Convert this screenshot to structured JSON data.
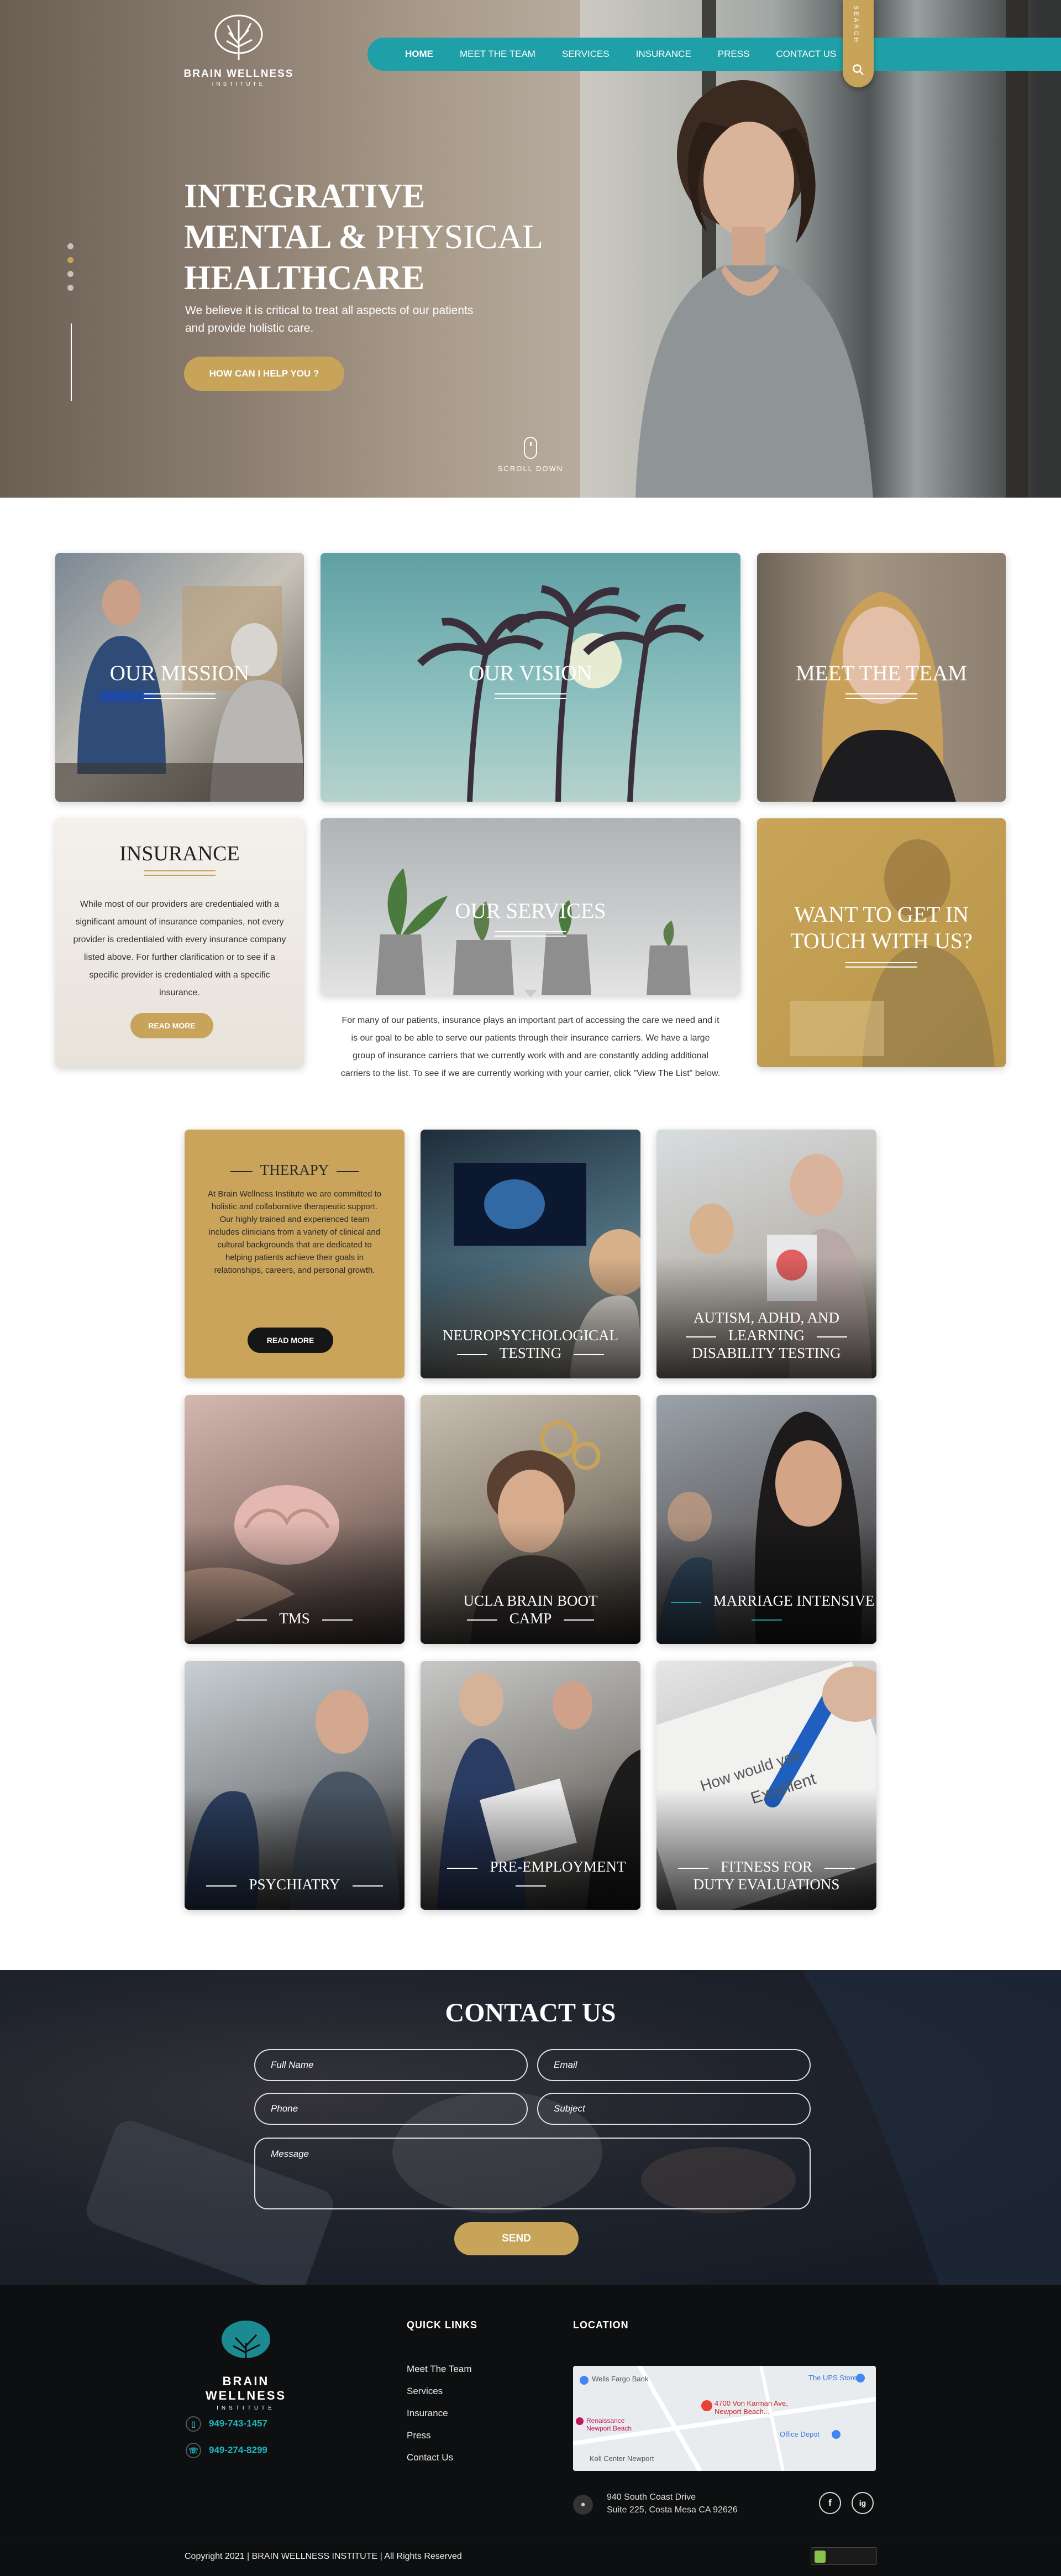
{
  "brand": {
    "name": "BRAIN WELLNESS",
    "sub": "INSTITUTE"
  },
  "nav": {
    "items": [
      "HOME",
      "MEET THE TEAM",
      "SERVICES",
      "INSURANCE",
      "PRESS",
      "CONTACT US"
    ],
    "search_label": "SEARCH"
  },
  "hero": {
    "title_line1": "INTEGRATIVE",
    "title_line2_bold": "MENTAL &",
    "title_line2_thin": "PHYSICAL",
    "title_line3": "HEALTHCARE",
    "description": "We believe it is critical to treat all aspects of our patients and provide holistic care.",
    "cta": "HOW CAN I HELP YOU ?",
    "scroll_label": "SCROLL DOWN",
    "active_slide": 1
  },
  "tiles": {
    "mission": "OUR MISSION",
    "vision": "OUR VISION",
    "team": "MEET THE TEAM",
    "insurance": {
      "title": "INSURANCE",
      "body": "While most of our providers are credentialed with a significant amount of insurance companies, not every provider is credentialed with every insurance company listed above. For further clarification or to see if a specific provider is credentialed with a specific insurance.",
      "button": "READ MORE"
    },
    "services": {
      "title": "OUR SERVICES",
      "body": "For many of our patients, insurance plays an important part of accessing the care we need and it is our goal to be able to serve our patients through their insurance carriers. We have a large group of insurance carriers that we currently work with and are constantly adding additional carriers to the list. To see if we are currently working with your carrier, click \"View The List\" below."
    },
    "contact": "WANT TO GET IN TOUCH WITH US?"
  },
  "services": {
    "therapy": {
      "title": "THERAPY",
      "body": "At Brain Wellness Institute we are committed to holistic and collaborative therapeutic support. Our highly trained and experienced team includes clinicians from a variety of clinical and cultural backgrounds that are dedicated to helping patients achieve their goals in relationships, careers, and personal growth.",
      "button": "READ MORE"
    },
    "items": [
      {
        "line1": "NEUROPSYCHOLOGICAL",
        "line2": "TESTING"
      },
      {
        "line1": "AUTISM, ADHD, AND",
        "line2": "LEARNING",
        "line3": "DISABILITY TESTING"
      },
      {
        "line1": "TMS"
      },
      {
        "line1": "UCLA BRAIN BOOT",
        "line2": "CAMP"
      },
      {
        "line1": "MARRIAGE INTENSIVE"
      },
      {
        "line1": "PSYCHIATRY"
      },
      {
        "line1": "PRE-EMPLOYMENT"
      },
      {
        "line1": "FITNESS FOR",
        "line2": "DUTY EVALUATIONS"
      }
    ]
  },
  "contact": {
    "title": "CONTACT US",
    "full_name": "Full Name",
    "email": "Email",
    "phone": "Phone",
    "subject": "Subject",
    "message": "Message",
    "send": "SEND"
  },
  "footer": {
    "phone1": "949-743-1457",
    "phone2": "949-274-8299",
    "quick_links_title": "QUICK LINKS",
    "quick_links": [
      "Meet The Team",
      "Services",
      "Insurance",
      "Press",
      "Contact Us"
    ],
    "location_title": "LOCATION",
    "map_labels": {
      "bank": "Wells Fargo Bank",
      "ups": "The UPS Store",
      "pin": "4700 Von Karman Ave, Newport Beach...",
      "office": "Office Depot",
      "renaissance": "Renaissance Newport Beach",
      "koll": "Koll Center Newport"
    },
    "address_line1": "940 South Coast Drive",
    "address_line2": "Suite 225, Costa Mesa CA 92626",
    "social": [
      "f",
      "ig"
    ],
    "copyright": "Copyright 2021 | BRAIN WELLNESS INSTITUTE | All Rights Reserved"
  },
  "colors": {
    "teal": "#1fa0a8",
    "gold": "#c8a45a",
    "dark": "#0e0f10"
  }
}
